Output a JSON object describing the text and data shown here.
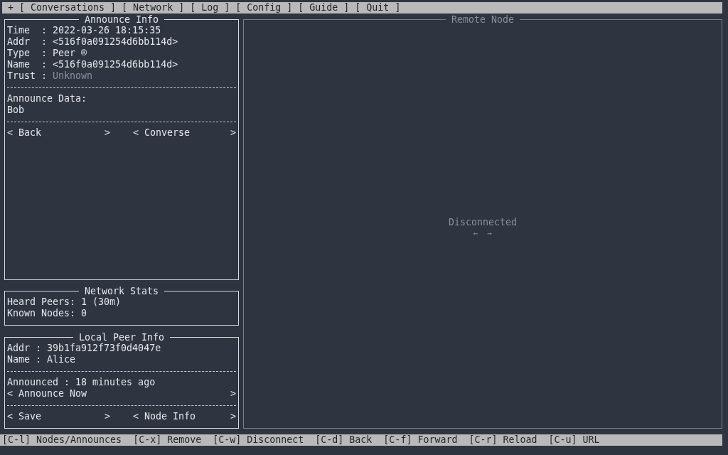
{
  "menu_bar": {
    "icon": "+",
    "items": [
      {
        "label": "[ Conversations ]"
      },
      {
        "label": "[ Network ]"
      },
      {
        "label": "[ Log ]"
      },
      {
        "label": "[ Config ]"
      },
      {
        "label": "[ Guide ]"
      },
      {
        "label": "[ Quit ]"
      }
    ]
  },
  "announce_info": {
    "title": "Announce Info",
    "fields": [
      {
        "label": "Time  : ",
        "value": "2022-03-26 18:15:35",
        "dim": false
      },
      {
        "label": "Addr  : ",
        "value": "<516f0a091254d6bb114d>",
        "dim": false
      },
      {
        "label": "Type  : ",
        "value": "Peer ®",
        "dim": false
      },
      {
        "label": "Name  : ",
        "value": "<516f0a091254d6bb114d>",
        "dim": false
      },
      {
        "label": "Trust : ",
        "value": "Unknown",
        "dim": true
      }
    ],
    "data_label": "Announce Data:",
    "data_value": "Bob",
    "buttons": [
      {
        "left": "<",
        "label": "Back",
        "right": ">"
      },
      {
        "left": "<",
        "label": "Converse",
        "right": ">"
      }
    ]
  },
  "network_stats": {
    "title": "Network Stats",
    "lines": [
      "Heard Peers: 1 (30m)",
      "Known Nodes: 0"
    ]
  },
  "local_peer_info": {
    "title": "Local Peer Info",
    "lines": [
      "Addr : 39b1fa912f73f0d4047e",
      "Name : Alice"
    ],
    "announced": "Announced : 18 minutes ago",
    "announce_button": {
      "left": "<",
      "label": "Announce Now",
      "right": ">"
    },
    "buttons": [
      {
        "left": "<",
        "label": "Save",
        "right": ">"
      },
      {
        "left": "<",
        "label": "Node Info",
        "right": ">"
      }
    ]
  },
  "remote_node": {
    "title": "Remote Node",
    "status": "Disconnected",
    "nav_back": "←",
    "nav_forward": "→"
  },
  "status_bar": [
    "[C-l] Nodes/Announces",
    "[C-x] Remove",
    "[C-w] Disconnect",
    "[C-d] Back",
    "[C-f] Forward",
    "[C-r] Reload",
    "[C-u] URL"
  ]
}
